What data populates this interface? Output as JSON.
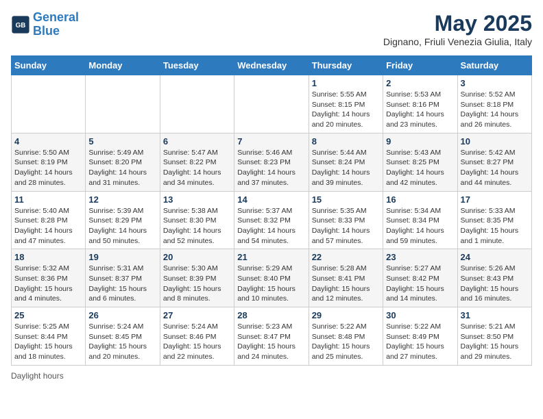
{
  "brand": {
    "name_line1": "General",
    "name_line2": "Blue"
  },
  "header": {
    "title": "May 2025",
    "subtitle": "Dignano, Friuli Venezia Giulia, Italy"
  },
  "weekdays": [
    "Sunday",
    "Monday",
    "Tuesday",
    "Wednesday",
    "Thursday",
    "Friday",
    "Saturday"
  ],
  "weeks": [
    [
      {
        "day": "",
        "info": ""
      },
      {
        "day": "",
        "info": ""
      },
      {
        "day": "",
        "info": ""
      },
      {
        "day": "",
        "info": ""
      },
      {
        "day": "1",
        "info": "Sunrise: 5:55 AM\nSunset: 8:15 PM\nDaylight: 14 hours\nand 20 minutes."
      },
      {
        "day": "2",
        "info": "Sunrise: 5:53 AM\nSunset: 8:16 PM\nDaylight: 14 hours\nand 23 minutes."
      },
      {
        "day": "3",
        "info": "Sunrise: 5:52 AM\nSunset: 8:18 PM\nDaylight: 14 hours\nand 26 minutes."
      }
    ],
    [
      {
        "day": "4",
        "info": "Sunrise: 5:50 AM\nSunset: 8:19 PM\nDaylight: 14 hours\nand 28 minutes."
      },
      {
        "day": "5",
        "info": "Sunrise: 5:49 AM\nSunset: 8:20 PM\nDaylight: 14 hours\nand 31 minutes."
      },
      {
        "day": "6",
        "info": "Sunrise: 5:47 AM\nSunset: 8:22 PM\nDaylight: 14 hours\nand 34 minutes."
      },
      {
        "day": "7",
        "info": "Sunrise: 5:46 AM\nSunset: 8:23 PM\nDaylight: 14 hours\nand 37 minutes."
      },
      {
        "day": "8",
        "info": "Sunrise: 5:44 AM\nSunset: 8:24 PM\nDaylight: 14 hours\nand 39 minutes."
      },
      {
        "day": "9",
        "info": "Sunrise: 5:43 AM\nSunset: 8:25 PM\nDaylight: 14 hours\nand 42 minutes."
      },
      {
        "day": "10",
        "info": "Sunrise: 5:42 AM\nSunset: 8:27 PM\nDaylight: 14 hours\nand 44 minutes."
      }
    ],
    [
      {
        "day": "11",
        "info": "Sunrise: 5:40 AM\nSunset: 8:28 PM\nDaylight: 14 hours\nand 47 minutes."
      },
      {
        "day": "12",
        "info": "Sunrise: 5:39 AM\nSunset: 8:29 PM\nDaylight: 14 hours\nand 50 minutes."
      },
      {
        "day": "13",
        "info": "Sunrise: 5:38 AM\nSunset: 8:30 PM\nDaylight: 14 hours\nand 52 minutes."
      },
      {
        "day": "14",
        "info": "Sunrise: 5:37 AM\nSunset: 8:32 PM\nDaylight: 14 hours\nand 54 minutes."
      },
      {
        "day": "15",
        "info": "Sunrise: 5:35 AM\nSunset: 8:33 PM\nDaylight: 14 hours\nand 57 minutes."
      },
      {
        "day": "16",
        "info": "Sunrise: 5:34 AM\nSunset: 8:34 PM\nDaylight: 14 hours\nand 59 minutes."
      },
      {
        "day": "17",
        "info": "Sunrise: 5:33 AM\nSunset: 8:35 PM\nDaylight: 15 hours\nand 1 minute."
      }
    ],
    [
      {
        "day": "18",
        "info": "Sunrise: 5:32 AM\nSunset: 8:36 PM\nDaylight: 15 hours\nand 4 minutes."
      },
      {
        "day": "19",
        "info": "Sunrise: 5:31 AM\nSunset: 8:37 PM\nDaylight: 15 hours\nand 6 minutes."
      },
      {
        "day": "20",
        "info": "Sunrise: 5:30 AM\nSunset: 8:39 PM\nDaylight: 15 hours\nand 8 minutes."
      },
      {
        "day": "21",
        "info": "Sunrise: 5:29 AM\nSunset: 8:40 PM\nDaylight: 15 hours\nand 10 minutes."
      },
      {
        "day": "22",
        "info": "Sunrise: 5:28 AM\nSunset: 8:41 PM\nDaylight: 15 hours\nand 12 minutes."
      },
      {
        "day": "23",
        "info": "Sunrise: 5:27 AM\nSunset: 8:42 PM\nDaylight: 15 hours\nand 14 minutes."
      },
      {
        "day": "24",
        "info": "Sunrise: 5:26 AM\nSunset: 8:43 PM\nDaylight: 15 hours\nand 16 minutes."
      }
    ],
    [
      {
        "day": "25",
        "info": "Sunrise: 5:25 AM\nSunset: 8:44 PM\nDaylight: 15 hours\nand 18 minutes."
      },
      {
        "day": "26",
        "info": "Sunrise: 5:24 AM\nSunset: 8:45 PM\nDaylight: 15 hours\nand 20 minutes."
      },
      {
        "day": "27",
        "info": "Sunrise: 5:24 AM\nSunset: 8:46 PM\nDaylight: 15 hours\nand 22 minutes."
      },
      {
        "day": "28",
        "info": "Sunrise: 5:23 AM\nSunset: 8:47 PM\nDaylight: 15 hours\nand 24 minutes."
      },
      {
        "day": "29",
        "info": "Sunrise: 5:22 AM\nSunset: 8:48 PM\nDaylight: 15 hours\nand 25 minutes."
      },
      {
        "day": "30",
        "info": "Sunrise: 5:22 AM\nSunset: 8:49 PM\nDaylight: 15 hours\nand 27 minutes."
      },
      {
        "day": "31",
        "info": "Sunrise: 5:21 AM\nSunset: 8:50 PM\nDaylight: 15 hours\nand 29 minutes."
      }
    ]
  ],
  "footer": {
    "note": "Daylight hours"
  }
}
